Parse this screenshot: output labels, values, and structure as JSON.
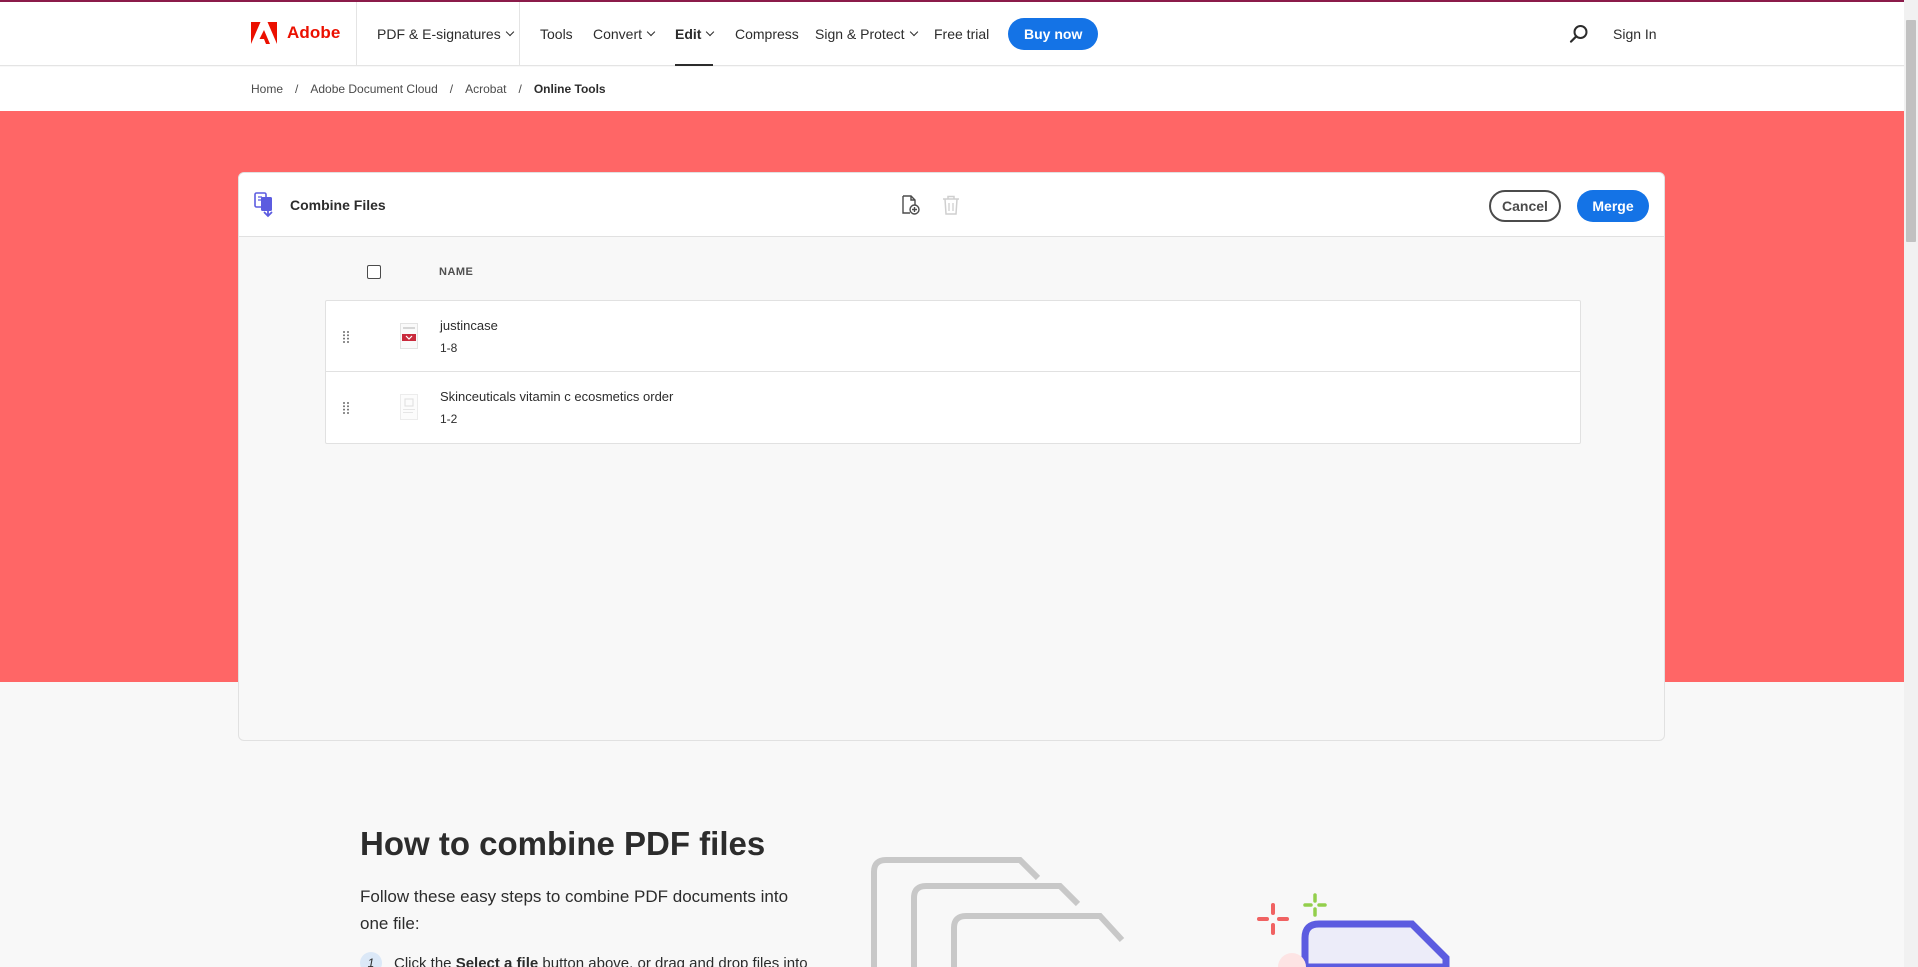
{
  "header": {
    "brand": "Adobe",
    "nav": [
      {
        "label": "PDF & E-signatures",
        "dropdown": true
      },
      {
        "label": "Tools",
        "dropdown": false
      },
      {
        "label": "Convert",
        "dropdown": true
      },
      {
        "label": "Edit",
        "dropdown": true,
        "active": true
      },
      {
        "label": "Compress",
        "dropdown": false
      },
      {
        "label": "Sign & Protect",
        "dropdown": true
      },
      {
        "label": "Free trial",
        "dropdown": false
      }
    ],
    "buy_label": "Buy now",
    "search_icon": "search-icon",
    "signin_label": "Sign In",
    "brand_color": "#eb1000",
    "accent_color": "#1473e6"
  },
  "breadcrumb": {
    "items": [
      "Home",
      "Adobe Document Cloud",
      "Acrobat"
    ],
    "current": "Online Tools",
    "separator": "/"
  },
  "hero": {
    "color": "#ff6666"
  },
  "tool": {
    "title": "Combine Files",
    "add_file_icon": "add-file-icon",
    "delete_icon": "trash-icon",
    "cancel_label": "Cancel",
    "merge_label": "Merge",
    "column_header": "NAME",
    "files": [
      {
        "name": "justincase",
        "pages": "1-8"
      },
      {
        "name": "Skinceuticals vitamin c ecosmetics order",
        "pages": "1-2"
      }
    ]
  },
  "howto": {
    "title": "How to combine PDF files",
    "subtitle": "Follow these easy steps to combine PDF documents into one file:",
    "step1": {
      "num": "1",
      "pre": "Click the ",
      "bold": "Select a file",
      "post": " button above, or drag and drop files into"
    }
  }
}
